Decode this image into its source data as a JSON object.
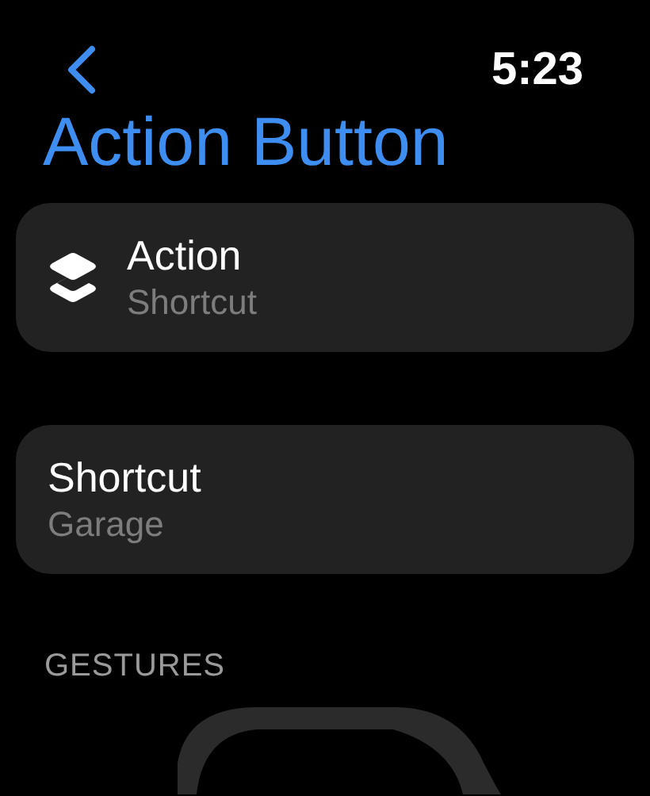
{
  "status_bar": {
    "time": "5:23"
  },
  "title": "Action Button",
  "cards": [
    {
      "kind": "icon",
      "title": "Action",
      "subtitle": "Shortcut"
    },
    {
      "kind": "plain",
      "title": "Shortcut",
      "subtitle": "Garage"
    }
  ],
  "section_header": "GESTURES"
}
